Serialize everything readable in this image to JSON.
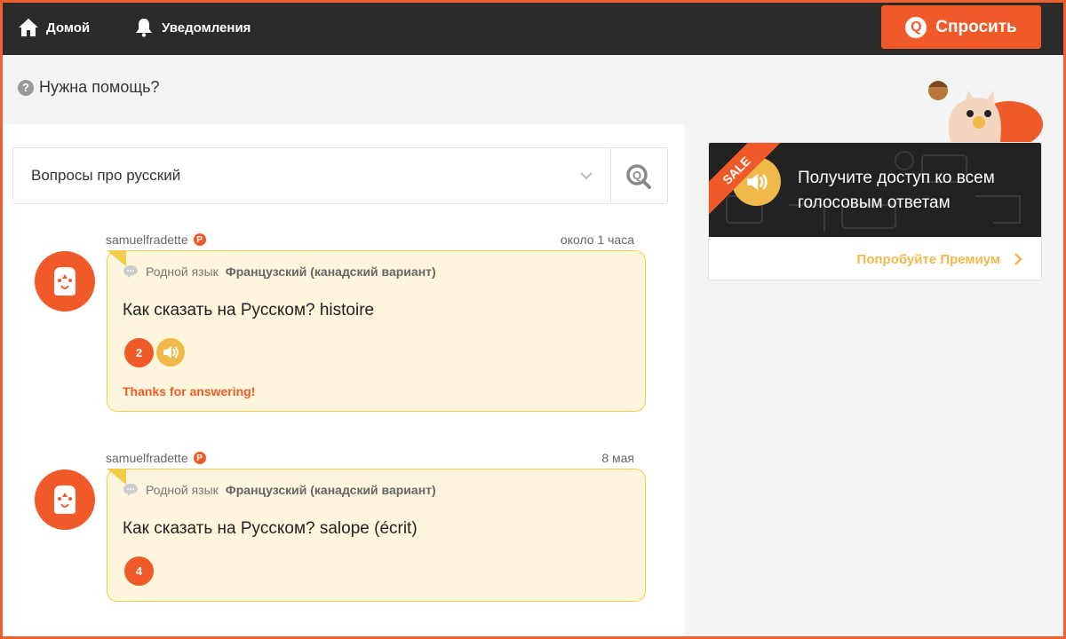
{
  "nav": {
    "home_label": "Домой",
    "notifications_label": "Уведомления",
    "ask_label": "Спросить",
    "ask_icon_letter": "Q"
  },
  "help": {
    "label": "Нужна помощь?",
    "icon_glyph": "?"
  },
  "search": {
    "label": "Вопросы про русский"
  },
  "questions": [
    {
      "user": "samuelfradette",
      "premium_glyph": "P",
      "time": "около 1 часа",
      "native_label": "Родной язык",
      "native_lang": "Французский (канадский вариант)",
      "text": "Как сказать на Русском? histoire",
      "answer_count": "2",
      "has_audio": true,
      "thanks": "Thanks for answering!"
    },
    {
      "user": "samuelfradette",
      "premium_glyph": "P",
      "time": "8 мая",
      "native_label": "Родной язык",
      "native_lang": "Французский (канадский вариант)",
      "text": "Как сказать на Русском? salope (écrit)",
      "answer_count": "4",
      "has_audio": false,
      "thanks": ""
    }
  ],
  "promo": {
    "sale_label": "SALE",
    "text": "Получите доступ ко всем голосовым ответам",
    "link_label": "Попробуйте Премиум"
  },
  "colors": {
    "accent": "#f05a28",
    "topbar": "#2b2b2b",
    "bubble_bg": "#fdf6dd",
    "bubble_border": "#f3cc4c",
    "gold": "#f0b94a"
  }
}
